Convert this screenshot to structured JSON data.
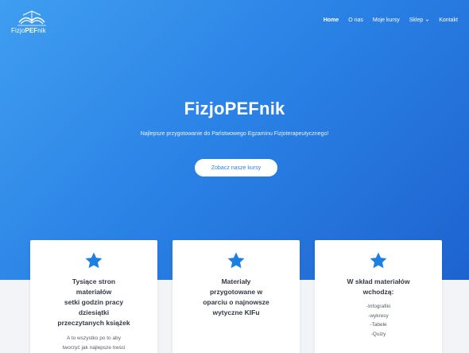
{
  "logo": {
    "text_plain": "Fizjo",
    "text_bold": "PEF",
    "text_tail": "nik"
  },
  "nav": {
    "items": [
      {
        "label": "Home"
      },
      {
        "label": "O nas"
      },
      {
        "label": "Moje kursy"
      },
      {
        "label": "Sklep"
      },
      {
        "label": "Kontakt"
      }
    ]
  },
  "hero": {
    "title": "FizjoPEFnik",
    "subtitle": "Najlepsze przygotowanie do Państwowego Egzaminu Fizjoterapeutycznego!",
    "button_label": "Zobacz nasze kursy"
  },
  "colors": {
    "hero_top": "#3f9ef0",
    "hero_bottom": "#1d63cf",
    "accent": "#1e7fe3",
    "text_dark": "#333a45"
  },
  "cards": [
    {
      "title_lines": [
        "Tysiące stron",
        "materiałów",
        "setki godzin pracy",
        "dziesiątki",
        "przeczytanych książek"
      ],
      "body_lines": [
        "A to wszystko po to aby",
        "tworzyć jak najlepsze treści"
      ],
      "icon": "star-icon"
    },
    {
      "title_lines": [
        "Materiały",
        "przygotowane w",
        "oparciu o najnowsze",
        "wytyczne KIFu"
      ],
      "body_lines": [],
      "icon": "star-icon"
    },
    {
      "title_lines": [
        "W skład materiałów",
        "wchodzą:"
      ],
      "body_lines": [
        "-Infografiki",
        "-wykresy",
        "-Tabele",
        "-Quizy"
      ],
      "icon": "star-icon"
    }
  ]
}
